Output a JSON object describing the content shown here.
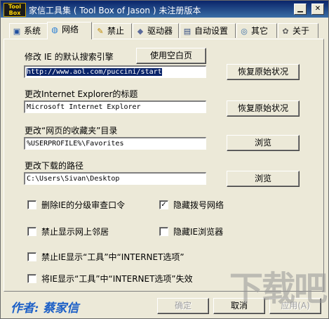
{
  "window": {
    "app_icon_lines": [
      "Tool",
      "Box"
    ],
    "title": "家信工具集 ( Tool Box of Jason ) 未注册版本",
    "min_glyph": "▁",
    "close_glyph": "✕"
  },
  "tabs": [
    {
      "label": "系统",
      "icon": "computer-icon",
      "glyph": "▣"
    },
    {
      "label": "网络",
      "icon": "network-icon",
      "glyph": "◍"
    },
    {
      "label": "禁止",
      "icon": "pencil-icon",
      "glyph": "✎"
    },
    {
      "label": "驱动器",
      "icon": "drive-icon",
      "glyph": "◆"
    },
    {
      "label": "自动设置",
      "icon": "monitor-icon",
      "glyph": "▤"
    },
    {
      "label": "其它",
      "icon": "globe-icon",
      "glyph": "◎"
    },
    {
      "label": "关于",
      "icon": "info-icon",
      "glyph": "✿"
    }
  ],
  "active_tab": "网络",
  "sections": {
    "search_engine": {
      "label": "修改 IE 的默认搜索引擎",
      "blank_page_button": "使用空白页",
      "value": "http://www.aol.com/puccini/start",
      "restore_button": "恢复原始状况"
    },
    "ie_title": {
      "label": "更改Internet Explorer的标题",
      "value": "Microsoft Internet Explorer",
      "restore_button": "恢复原始状况"
    },
    "favorites": {
      "label": "更改“网页的收藏夹”目录",
      "value": "%USERPROFILE%\\Favorites",
      "browse_button": "浏览"
    },
    "download": {
      "label": "更改下载的路径",
      "value": "C:\\Users\\Sivan\\Desktop",
      "browse_button": "浏览"
    }
  },
  "options": [
    {
      "label": "删除IE的分级审查口令",
      "checked": false
    },
    {
      "label": "隐藏拨号网络",
      "checked": true
    },
    {
      "label": "禁止显示网上邻居",
      "checked": false
    },
    {
      "label": "隐藏IE浏览器",
      "checked": false
    },
    {
      "label": "禁止IE显示“工具”中“INTERNET选项”",
      "checked": false
    },
    {
      "label": "将IE显示“工具”中“INTERNET选项”失效",
      "checked": false
    }
  ],
  "footer": {
    "author": "作者: 蔡家信",
    "ok_button": "确定",
    "cancel_button": "取消",
    "apply_button": "应用(A)"
  },
  "watermark_text": "下载吧",
  "colors": {
    "title_bar": "#0a246a",
    "author": "#1b5fc7",
    "selection": "#0a246a"
  }
}
